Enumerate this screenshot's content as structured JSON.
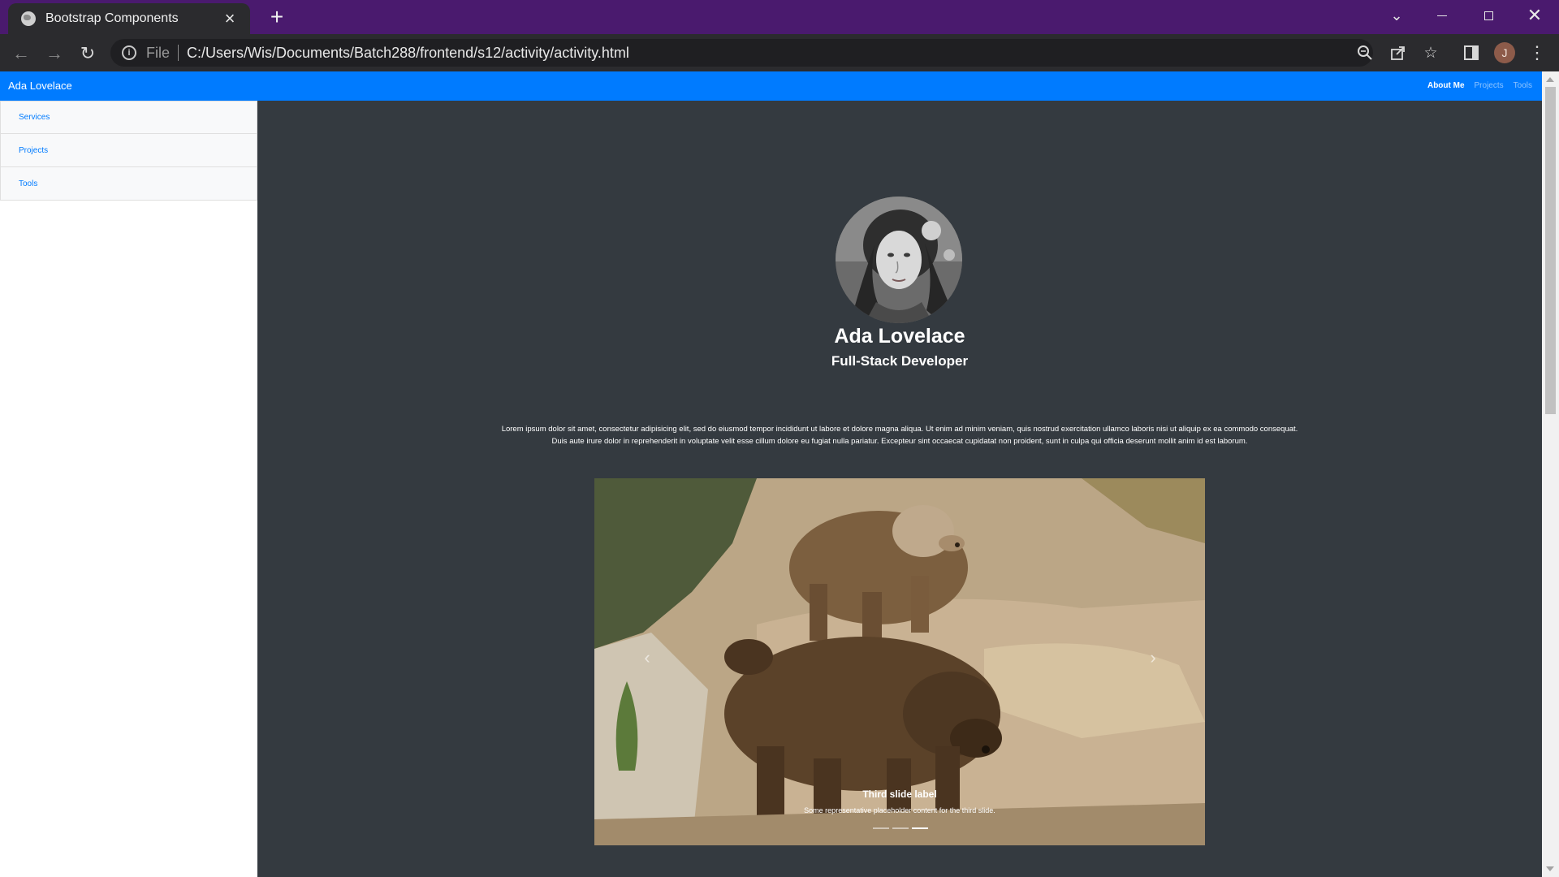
{
  "browser": {
    "tab_title": "Bootstrap Components",
    "url_scheme_label": "File",
    "url": "C:/Users/Wis/Documents/Batch288/frontend/s12/activity/activity.html",
    "profile_initial": "J"
  },
  "navbar": {
    "brand": "Ada Lovelace",
    "links": [
      {
        "label": "About Me",
        "active": true
      },
      {
        "label": "Projects",
        "active": false
      },
      {
        "label": "Tools",
        "active": false
      }
    ]
  },
  "sidebar": {
    "items": [
      {
        "label": "Services"
      },
      {
        "label": "Projects"
      },
      {
        "label": "Tools"
      }
    ]
  },
  "profile": {
    "name": "Ada Lovelace",
    "role": "Full-Stack Developer",
    "bio": "Lorem ipsum dolor sit amet, consectetur adipisicing elit, sed do eiusmod tempor incididunt ut labore et dolore magna aliqua. Ut enim ad minim veniam, quis nostrud exercitation ullamco laboris nisi ut aliquip ex ea commodo consequat. Duis aute irure dolor in reprehenderit in voluptate velit esse cillum dolore eu fugiat nulla pariatur. Excepteur sint occaecat cupidatat non proident, sunt in culpa qui officia deserunt mollit anim id est laborum."
  },
  "carousel": {
    "caption_title": "Third slide label",
    "caption_text": "Some representative placeholder content for the third slide.",
    "active_slide": 3,
    "slide_count": 3
  },
  "colors": {
    "tab_strip": "#4a1a6e",
    "navbar": "#007bff",
    "page_background": "#343a40",
    "link": "#007bff"
  }
}
